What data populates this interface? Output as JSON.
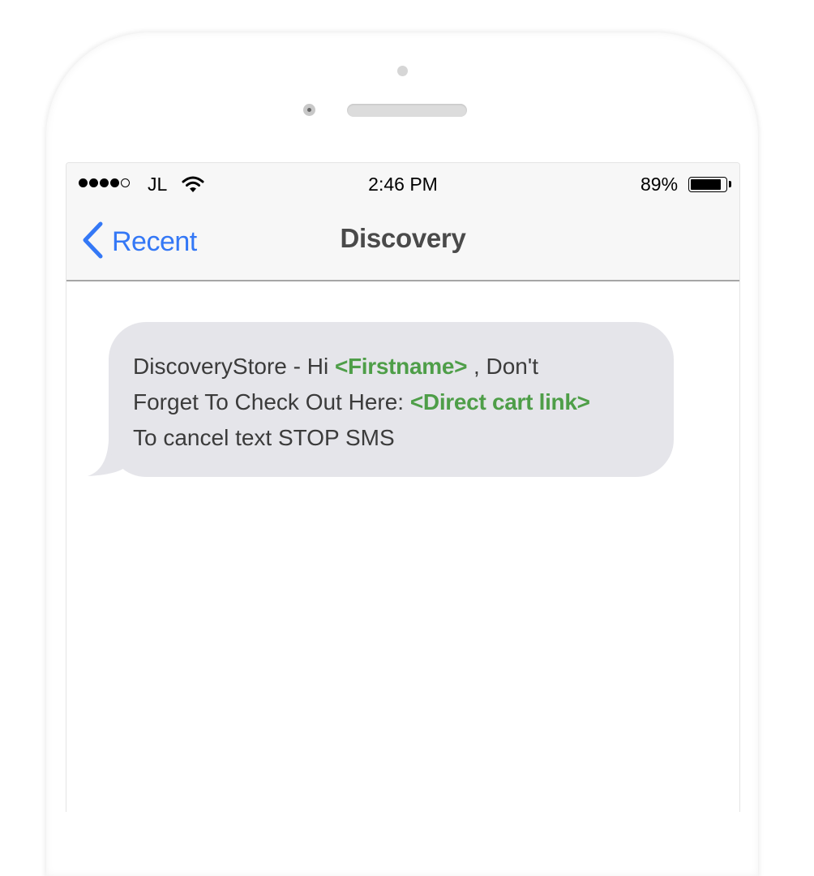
{
  "status_bar": {
    "signal_strength": "4 of 5",
    "carrier": "JL",
    "wifi_icon": "wifi-icon",
    "time": "2:46 PM",
    "battery_percent": "89%",
    "battery_level": 0.89
  },
  "nav": {
    "back_icon": "chevron-left-icon",
    "back_label": "Recent",
    "title": "Discovery"
  },
  "message": {
    "line1_prefix": "DiscoveryStore - Hi ",
    "line1_placeholder": "<Firstname>",
    "line1_suffix": " , Don't",
    "line2_prefix": "Forget To Check Out Here: ",
    "line2_placeholder": "<Direct cart link>",
    "line3": "To cancel text STOP SMS"
  },
  "colors": {
    "link_blue": "#3478f6",
    "placeholder_green": "#4e9e48",
    "bubble_gray": "#e5e5ea"
  }
}
